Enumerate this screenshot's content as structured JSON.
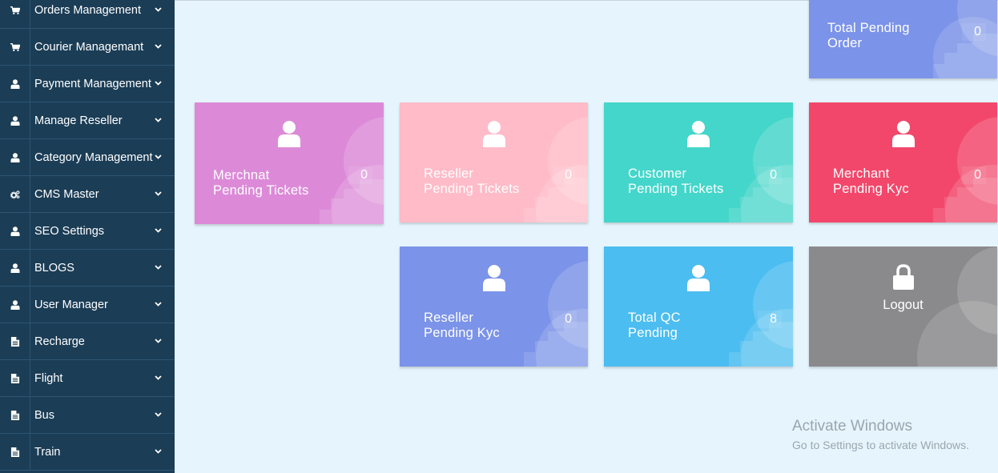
{
  "sidebar": {
    "items": [
      {
        "label": "Orders Management",
        "icon": "cart-icon"
      },
      {
        "label": "Courier Managemant",
        "icon": "cart-icon"
      },
      {
        "label": "Payment Management",
        "icon": "user-icon"
      },
      {
        "label": "Manage Reseller",
        "icon": "user-icon"
      },
      {
        "label": "Category Management",
        "icon": "user-icon"
      },
      {
        "label": "CMS Master",
        "icon": "cogs-icon"
      },
      {
        "label": "SEO Settings",
        "icon": "user-icon"
      },
      {
        "label": "BLOGS",
        "icon": "user-icon"
      },
      {
        "label": "User Manager",
        "icon": "user-icon"
      },
      {
        "label": "Recharge",
        "icon": "document-icon"
      },
      {
        "label": "Flight",
        "icon": "document-icon"
      },
      {
        "label": "Bus",
        "icon": "document-icon"
      },
      {
        "label": "Train",
        "icon": "document-icon"
      }
    ]
  },
  "cards": {
    "total_pending_order": {
      "title": "Total Pending\nOrder",
      "count": "0",
      "color": "#7b93e8"
    },
    "merchant_pending_tickets": {
      "title": "Merchnat\nPending Tickets",
      "count": "0",
      "color": "#dc8ad8"
    },
    "reseller_pending_tickets": {
      "title": "Reseller\nPending Tickets",
      "count": "0",
      "color": "#ffbbc8"
    },
    "customer_pending_tickets": {
      "title": "Customer\nPending Tickets",
      "count": "0",
      "color": "#44d6ca"
    },
    "merchant_pending_kyc": {
      "title": "Merchant\nPending Kyc",
      "count": "0",
      "color": "#f2476b"
    },
    "reseller_pending_kyc": {
      "title": "Reseller\nPending Kyc",
      "count": "0",
      "color": "#7b93e8"
    },
    "total_qc_pending": {
      "title": "Total QC\nPending",
      "count": "8",
      "color": "#4bbdf0"
    },
    "logout": {
      "title": "Logout",
      "color": "#8a8a8c"
    }
  },
  "watermark": {
    "title": "Activate Windows",
    "subtitle": "Go to Settings to activate Windows."
  }
}
